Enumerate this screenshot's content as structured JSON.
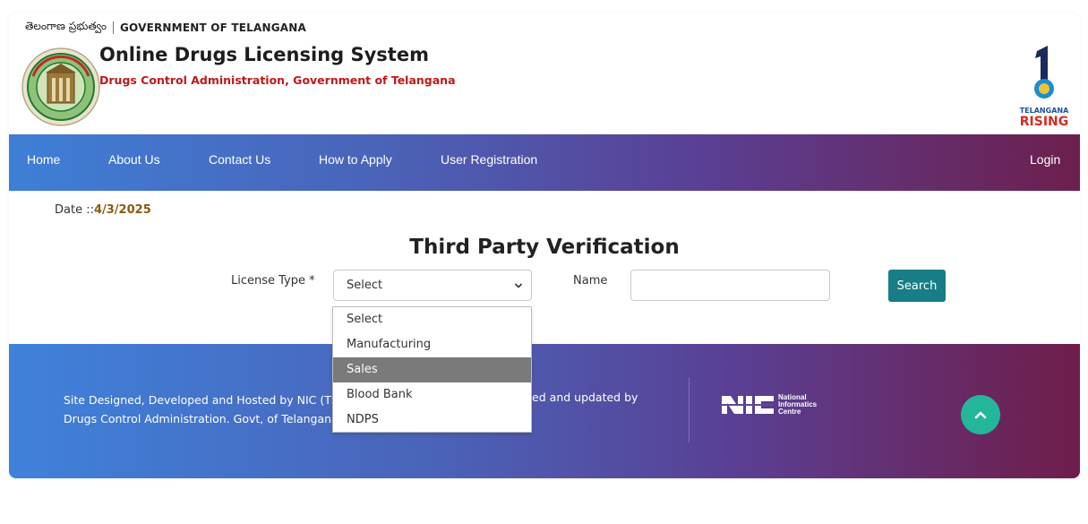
{
  "header": {
    "telugu_gov": "తెలంగాణ ప్రభుత్వం",
    "gov_label": "GOVERNMENT OF TELANGANA",
    "title": "Online Drugs Licensing System",
    "subtitle": "Drugs Control Administration, Government of Telangana",
    "rising_top": "TELANGANA",
    "rising_bottom": "RISING"
  },
  "nav": {
    "items": [
      "Home",
      "About Us",
      "Contact Us",
      "How to Apply",
      "User Registration"
    ],
    "login": "Login"
  },
  "date": {
    "label": "Date ::",
    "value": "4/3/2025"
  },
  "verification": {
    "title": "Third Party Verification",
    "license_label": "License Type *",
    "license_selected": "Select",
    "name_label": "Name",
    "name_value": "",
    "search_label": "Search"
  },
  "dropdown": {
    "options": [
      "Select",
      "Manufacturing",
      "Sales",
      "Blood Bank",
      "NDPS"
    ],
    "highlighted": "Sales"
  },
  "footer": {
    "line1": "Site Designed, Developed and Hosted by NIC (TS",
    "line2": "Drugs Control Administration. Govt, of Telangana",
    "line1_right": "ained and updated by",
    "nic_1": "National",
    "nic_2": "Informatics",
    "nic_3": "Centre"
  },
  "colors": {
    "accent_teal": "#177d86",
    "scroll_up": "#22b79a",
    "subtitle_red": "#c01919"
  }
}
